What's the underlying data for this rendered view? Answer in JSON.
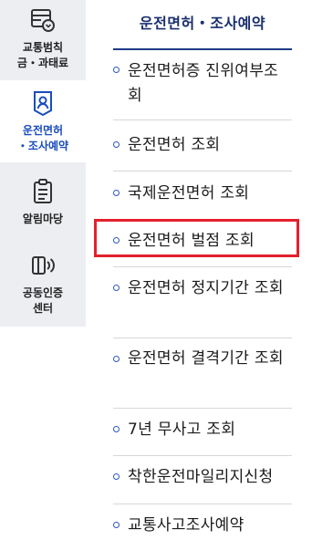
{
  "rail": {
    "items": [
      {
        "label": "교통범칙\n금・과태료",
        "icon": "bill-list-icon"
      },
      {
        "label": "운전면허\n・조사예약",
        "icon": "license-badge-icon",
        "active": true
      },
      {
        "label": "알림마당",
        "icon": "clipboard-icon"
      },
      {
        "label": "공동인증\n센터",
        "icon": "speaker-certificate-icon"
      }
    ]
  },
  "menu": {
    "title": "운전면허・조사예약",
    "items": [
      {
        "label": "운전면허증 진위여부조회"
      },
      {
        "label": "운전면허 조회"
      },
      {
        "label": "국제운전면허 조회"
      },
      {
        "label": "운전면허 벌점 조회"
      },
      {
        "label": "운전면허 정지기간 조회"
      },
      {
        "label": "운전면허 결격기간 조회"
      },
      {
        "label": "7년 무사고 조회"
      },
      {
        "label": "착한운전마일리지신청"
      },
      {
        "label": "교통사고조사예약"
      }
    ],
    "highlighted_index": 3
  },
  "colors": {
    "accent": "#1a4cbd",
    "title": "#1a2f6e",
    "highlight_border": "#e3202c",
    "rail_bg": "#eceef2"
  }
}
